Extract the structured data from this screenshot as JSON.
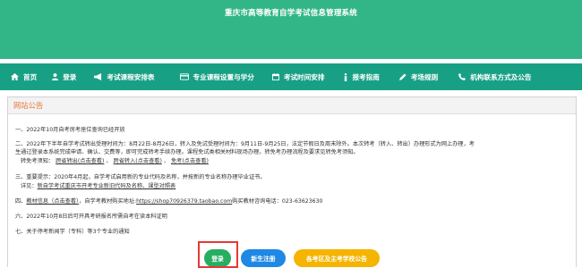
{
  "header": {
    "title": "重庆市高等教育自学考试信息管理系统"
  },
  "nav": {
    "items": [
      {
        "label": "首页",
        "icon": "home-icon"
      },
      {
        "label": "登录",
        "icon": "user-icon"
      },
      {
        "label": "考试课程安排表",
        "icon": "bullhorn-icon"
      },
      {
        "label": "专业课程设置与学分",
        "icon": "credit-card-icon"
      },
      {
        "label": "考试时间安排",
        "icon": "calendar-icon"
      },
      {
        "label": "报考指南",
        "icon": "info-icon"
      },
      {
        "label": "考场规则",
        "icon": "pencil-icon"
      },
      {
        "label": "机构联系方式及公告",
        "icon": "phone-icon"
      }
    ]
  },
  "notice": {
    "title": "网站公告",
    "item1": "一、2022年10月自考房考座位查询已经开放",
    "item2a": "二、2022年下半年自学考试转出受理时间为：8月22日-8月26日，转入及免试受理时间为：9月11日-9月25日，法定节假日及周末除外。本次转考（转入、转出）办理形式为网上办理，考",
    "item2b": "生通过登录本系统完成申请、确认、交费等，即可完成转考手续办理。课程免试类相关材料现场办理。转免考办理流程及要求见转免考须知。",
    "item2c_prefix": "转免考须知：",
    "item2c_link1": "跨省转出(点击查看)",
    "item2c_link2": "跨省转入(点击查看)",
    "item2c_link3": "免考(点击查看)",
    "item3a": "三、重要提示：2020年4月起，自学考试启用新的专业代码及名称，并按新的专业名称办理毕业证书。",
    "item3b_prefix": "详见：",
    "item3b_link1": "新自学考试重庆市开考专业新旧代码及名称、课型对照表",
    "item4_prefix": "四、",
    "item4_link": "教材信息（点击查看）",
    "item4_mid": "，自学考教材购买地址:",
    "item4_link2": "https://shop70926379.taobao.com",
    "item4_suffix": "购买教材咨询电话：023-63623630",
    "item5": "六、2022年10月8日后可开具考研报名所需自考在读本科证明",
    "item6": "七、关于停考新闻学（专科）等3个专业的通知"
  },
  "buttons": {
    "login": "登录",
    "register": "新生注册",
    "contact": "各考区及主考学校公告"
  },
  "colors": {
    "header_bg": "#33b687",
    "nav_bg": "#18a085",
    "title_orange": "#e87a3a",
    "login_green": "#27ae60",
    "register_blue": "#1e88e5",
    "contact_yellow": "#f5b400",
    "highlight_red": "#e53935"
  }
}
